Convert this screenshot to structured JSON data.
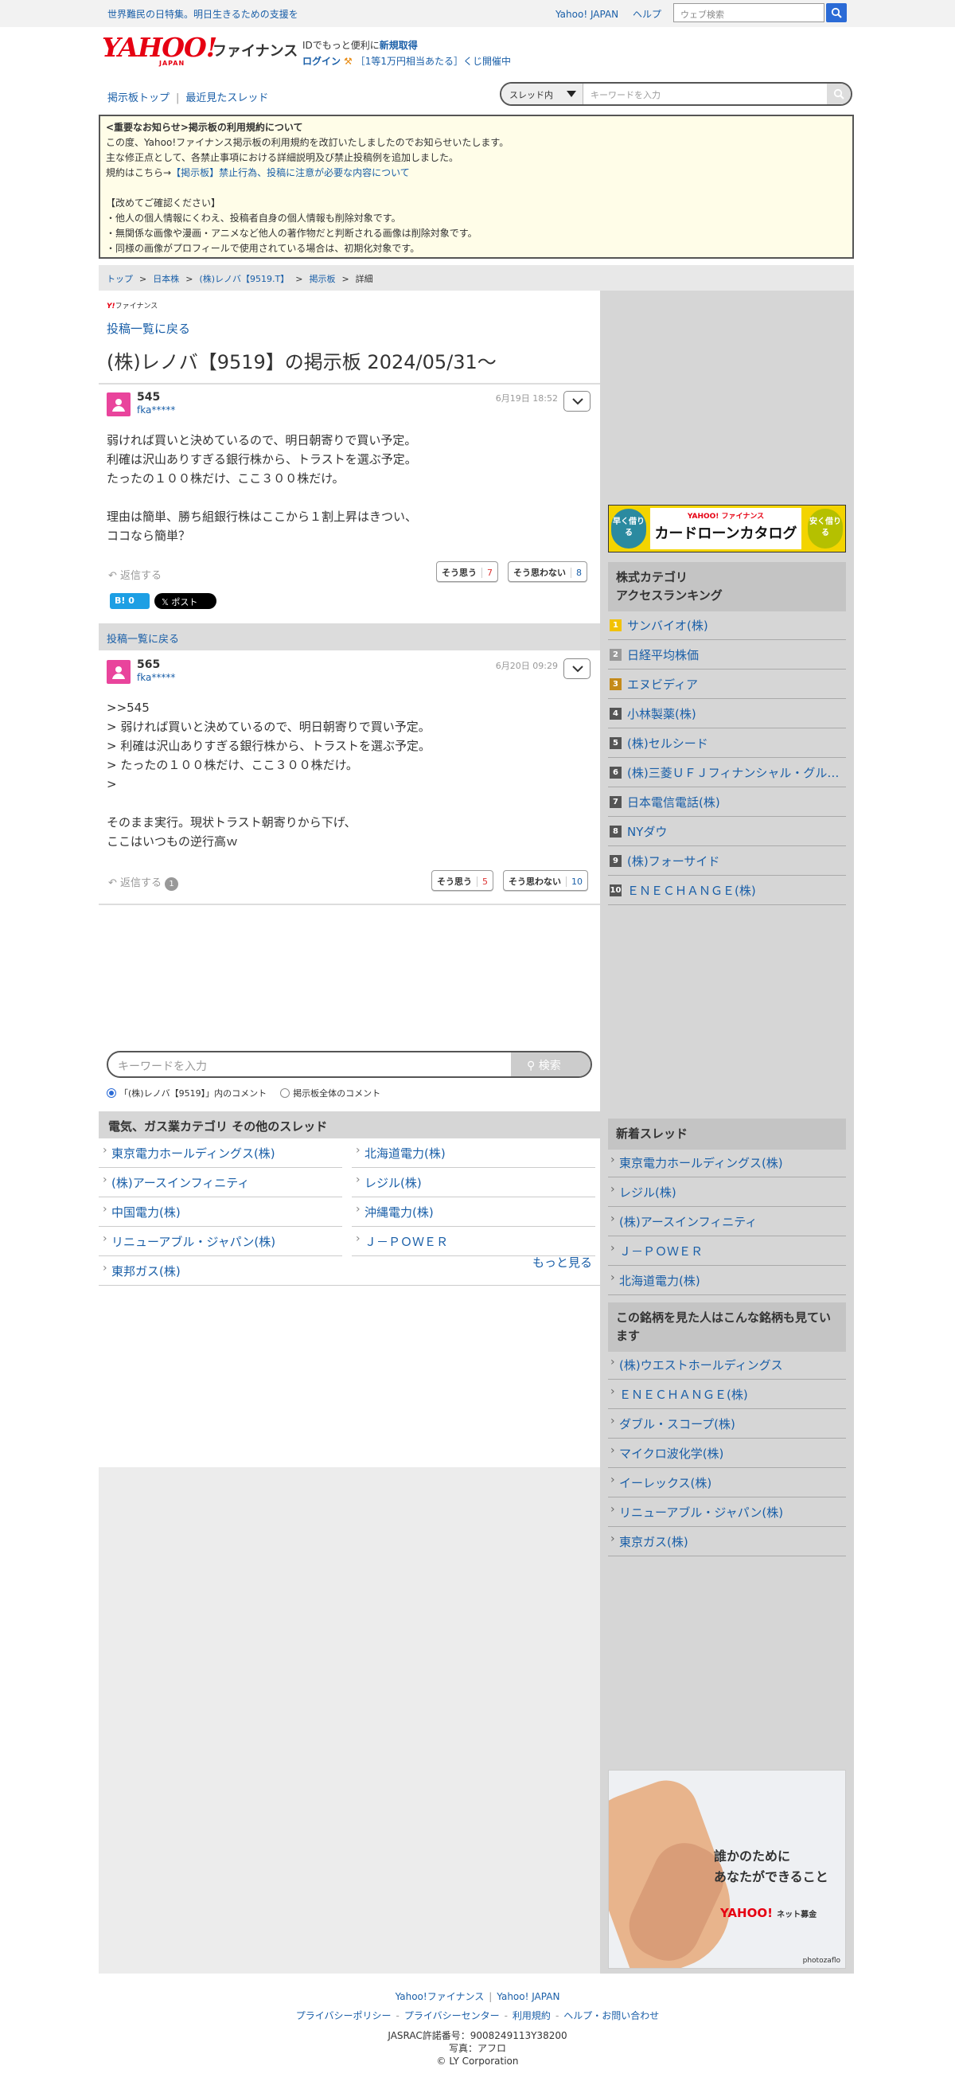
{
  "topbar": {
    "promo": "世界難民の日特集。明日生きるための支援を",
    "links": [
      "Yahoo! JAPAN",
      "ヘルプ"
    ],
    "search_placeholder": "ウェブ検索"
  },
  "header": {
    "logo_main": "YAHOO!",
    "logo_sub": "JAPAN",
    "logo_finance": "ファイナンス",
    "id_text": "IDでもっと便利に",
    "id_signup": "新規取得",
    "login": "ログイン",
    "lottery": "［1等1万円相当あたる］くじ開催中"
  },
  "nav": {
    "board_top": "掲示板トップ",
    "recent_threads": "最近見たスレッド",
    "scope": "スレッド内",
    "search_placeholder": "キーワードを入力"
  },
  "notice": {
    "title": "<重要なお知らせ>掲示板の利用規約について",
    "lines": [
      "この度、Yahoo!ファイナンス掲示板の利用規約を改訂いたしましたのでお知らせいたします。",
      "主な修正点として、各禁止事項における詳細説明及び禁止投稿例を追加しました。"
    ],
    "rules_prefix": "規約はこちら→",
    "rules_link": "【掲示板】禁止行為、投稿に注意が必要な内容について",
    "check_title": "【改めてご確認ください】",
    "checks": [
      "・他人の個人情報にくわえ、投稿者自身の個人情報も削除対象です。",
      "・無関係な画像や漫画・アニメなど他人の著作物だと判断される画像は削除対象です。",
      "・同様の画像がプロフィールで使用されている場合は、初期化対象です。"
    ]
  },
  "breadcrumb": [
    "トップ",
    "日本株",
    "(株)レノバ【9519.T】",
    "掲示板",
    "詳細"
  ],
  "board": {
    "mini_logo_y": "Y!",
    "mini_logo_text": "ファイナンス",
    "back_label": "投稿一覧に戻る",
    "title": "(株)レノバ【9519】の掲示板 2024/05/31〜"
  },
  "posts": [
    {
      "number": "545",
      "user": "fka*****",
      "date": "6月19日 18:52",
      "body": "弱ければ買いと決めているので、明日朝寄りで買い予定。\n利確は沢山ありすぎる銀行株から、トラストを選ぶ予定。\nたったの１００株だけ、ここ３００株だけ。\n\n理由は簡単、勝ち組銀行株はここから１割上昇はきつい、\nココなら簡単？",
      "reply_label": "返信する",
      "reply_count": "",
      "agree_label": "そう思う",
      "agree_count": "7",
      "disagree_label": "そう思わない",
      "disagree_count": "8"
    },
    {
      "number": "565",
      "user": "fka*****",
      "date": "6月20日 09:29",
      "body": ">>545\n> 弱ければ買いと決めているので、明日朝寄りで買い予定。\n> 利確は沢山ありすぎる銀行株から、トラストを選ぶ予定。\n> たったの１００株だけ、ここ３００株だけ。\n>\n\nそのまま実行。現状トラスト朝寄りから下げ、\nここはいつもの逆行高ｗ",
      "reply_label": "返信する",
      "reply_count": "1",
      "agree_label": "そう思う",
      "agree_count": "5",
      "disagree_label": "そう思わない",
      "disagree_count": "10"
    }
  ],
  "share": {
    "hatena": "B! 0",
    "x": "𝕏 ポスト"
  },
  "comment_search": {
    "placeholder": "キーワードを入力",
    "button": "検索",
    "scope_thread": "「(株)レノバ【9519】」内のコメント",
    "scope_all": "掲示板全体のコメント"
  },
  "other_threads": {
    "title": "電気、ガス業カテゴリ その他のスレッド",
    "items": [
      "東京電力ホールディングス(株)",
      "北海道電力(株)",
      "(株)アースインフィニティ",
      "レジル(株)",
      "中国電力(株)",
      "沖縄電力(株)",
      "リニューアブル・ジャパン(株)",
      "Ｊ－ＰＯＷＥＲ",
      "東邦ガス(株)"
    ],
    "more": "もっと見る"
  },
  "sidebar": {
    "banner": {
      "left": "早く借りる",
      "brand": "YAHOO! ファイナンス",
      "title": "カードローンカタログ",
      "right": "安く借りる"
    },
    "ranking_title": "株式カテゴリ\nアクセスランキング",
    "ranking": [
      {
        "rank": "1",
        "name": "サンバイオ(株)"
      },
      {
        "rank": "2",
        "name": "日経平均株価"
      },
      {
        "rank": "3",
        "name": "エヌビディア"
      },
      {
        "rank": "4",
        "name": "小林製薬(株)"
      },
      {
        "rank": "5",
        "name": "(株)セルシード"
      },
      {
        "rank": "6",
        "name": "(株)三菱ＵＦＪフィナンシャル・グループ"
      },
      {
        "rank": "7",
        "name": "日本電信電話(株)"
      },
      {
        "rank": "8",
        "name": "NYダウ"
      },
      {
        "rank": "9",
        "name": "(株)フォーサイド"
      },
      {
        "rank": "10",
        "name": "ＥＮＥＣＨＡＮＧＥ(株)"
      }
    ],
    "new_threads_title": "新着スレッド",
    "new_threads": [
      "東京電力ホールディングス(株)",
      "レジル(株)",
      "(株)アースインフィニティ",
      "Ｊ－ＰＯＷＥＲ",
      "北海道電力(株)"
    ],
    "also_viewed_title": "この銘柄を見た人はこんな銘柄も見ています",
    "also_viewed": [
      "(株)ウエストホールディングス",
      "ＥＮＥＣＨＡＮＧＥ(株)",
      "ダブル・スコープ(株)",
      "マイクロ波化学(株)",
      "イーレックス(株)",
      "リニューアブル・ジャパン(株)",
      "東京ガス(株)"
    ],
    "ad": {
      "message_1": "誰かのために",
      "message_2": "あなたができること",
      "brand": "YAHOO!",
      "brand_sub": "ネット募金",
      "credit": "photozaflo"
    }
  },
  "footer": {
    "row1": [
      "Yahoo!ファイナンス",
      "Yahoo! JAPAN"
    ],
    "row2": [
      "プライバシーポリシー",
      "プライバシーセンター",
      "利用規約",
      "ヘルプ・お問い合わせ"
    ],
    "jasrac": "JASRAC許諾番号：9008249113Y38200",
    "photo": "写真：アフロ",
    "copyright": "© LY Corporation"
  }
}
